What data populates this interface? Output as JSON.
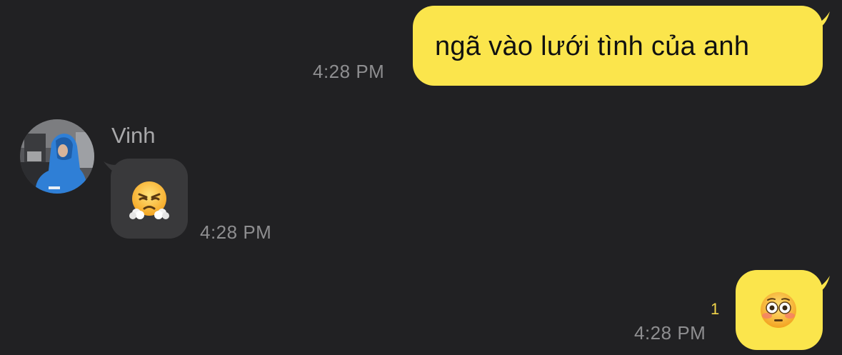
{
  "messages": [
    {
      "direction": "outgoing",
      "text": "ngã vào lưới tình của anh",
      "time": "4:28 PM"
    },
    {
      "direction": "incoming",
      "sender": "Vinh",
      "emoji_icon": "face-with-steam-from-nose-icon",
      "time": "4:28 PM"
    },
    {
      "direction": "outgoing",
      "emoji_icon": "flushed-face-icon",
      "unread_count": "1",
      "time": "4:28 PM"
    }
  ],
  "colors": {
    "background": "#212123",
    "outgoing_bubble": "#fbe54c",
    "incoming_bubble": "#39393b",
    "timestamp": "#8e8e90",
    "unread": "#f3d64a"
  }
}
